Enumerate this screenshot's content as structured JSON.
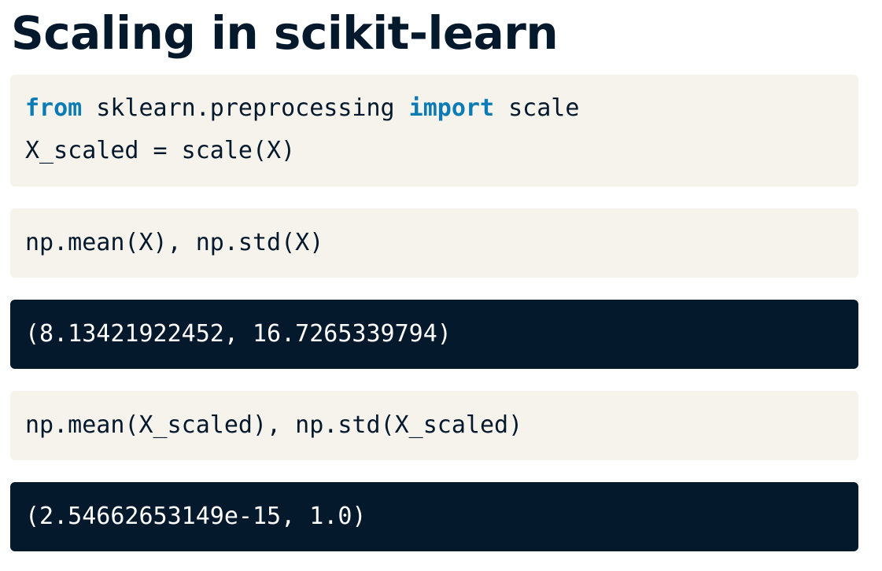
{
  "title": "Scaling in scikit-learn",
  "colors": {
    "title": "#05192d",
    "code_background": "#f6f2ec",
    "output_background": "#05192d",
    "keyword": "#0b7bb5",
    "output_text": "#ffffff"
  },
  "blocks": [
    {
      "kind": "code",
      "lines": [
        {
          "kw1": "from",
          "t1": " sklearn.preprocessing ",
          "kw2": "import",
          "t2": " scale"
        },
        {
          "text": "X_scaled = scale(X)"
        }
      ]
    },
    {
      "kind": "code",
      "text": "np.mean(X), np.std(X)"
    },
    {
      "kind": "output",
      "text": "(8.13421922452, 16.7265339794)"
    },
    {
      "kind": "code",
      "text": "np.mean(X_scaled), np.std(X_scaled)"
    },
    {
      "kind": "output",
      "text": "(2.54662653149e-15, 1.0)"
    }
  ]
}
